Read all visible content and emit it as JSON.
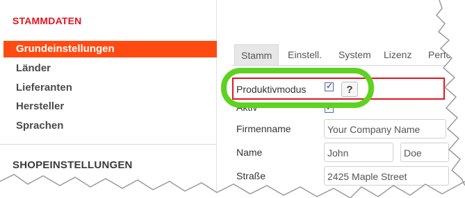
{
  "sidebar": {
    "section_stammdaten": "STAMMDATEN",
    "items": [
      {
        "label": "Grundeinstellungen",
        "active": true
      },
      {
        "label": "Länder"
      },
      {
        "label": "Lieferanten"
      },
      {
        "label": "Hersteller"
      },
      {
        "label": "Sprachen"
      }
    ],
    "section_shop": "SHOPEINSTELLUNGEN"
  },
  "tabs": [
    "Stamm",
    "Einstell.",
    "System",
    "Lizenz",
    "Perfo"
  ],
  "form": {
    "produktivmodus_label": "Produktivmodus",
    "help_label": "?",
    "aktiv_label": "Aktiv",
    "firmenname_label": "Firmenname",
    "firmenname_value": "Your Company Name",
    "name_label": "Name",
    "first_name_value": "John",
    "last_name_value": "Doe",
    "strasse_label": "Straße",
    "strasse_value": "2425 Maple Street"
  },
  "colors": {
    "accent": "#ff4b12",
    "section_title": "#e3141f",
    "highlight_green": "#5dd21f",
    "highlight_red": "#e3141f"
  }
}
